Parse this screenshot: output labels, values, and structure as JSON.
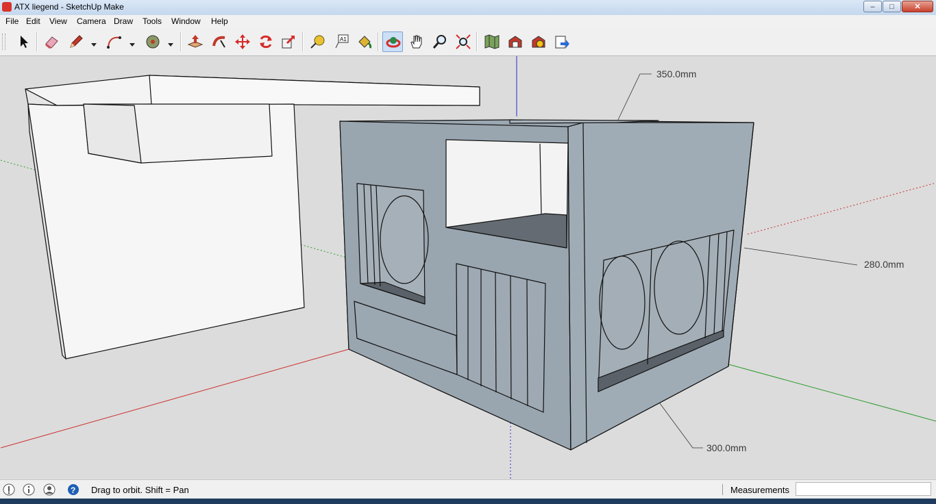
{
  "window": {
    "title": "ATX liegend - SketchUp Make"
  },
  "menu": [
    "File",
    "Edit",
    "View",
    "Camera",
    "Draw",
    "Tools",
    "Window",
    "Help"
  ],
  "toolbar": {
    "tools": [
      "select",
      "eraser",
      "pencil",
      "arc",
      "paint",
      "push-pull",
      "follow-me",
      "move",
      "rotate",
      "scale",
      "tape-measure",
      "text",
      "paint-bucket",
      "orbit",
      "pan",
      "zoom",
      "zoom-extents",
      "components",
      "3d-warehouse",
      "extension-warehouse",
      "share-model"
    ],
    "active_tool": "orbit"
  },
  "viewport": {
    "dimensions": {
      "top": "350.0mm",
      "right": "280.0mm",
      "bottom": "300.0mm"
    },
    "colors": {
      "background": "#dcdcdc",
      "model_face": "#9ba7b1",
      "axis_red": "#cc2a2a",
      "axis_green": "#2a9a2a",
      "axis_blue": "#2a2ad0"
    }
  },
  "status": {
    "hint": "Drag to orbit.  Shift = Pan",
    "measurements_label": "Measurements",
    "measurements_value": ""
  }
}
